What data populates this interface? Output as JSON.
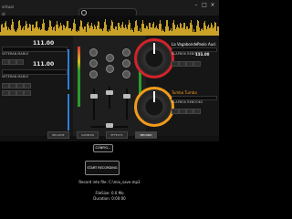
{
  "app": {
    "logo_text": "virtual dj"
  },
  "search": {
    "placeholder": ""
  },
  "window_controls": [
    "–",
    "□",
    "×"
  ],
  "deck_left": {
    "bpm": "111.00",
    "track_top": "VETERAN MARLE",
    "track_bottom": "VETERAN MARLE"
  },
  "deck_right": {
    "title": "La Vagabonde",
    "artist": "Paolo Auci",
    "track_top": "SLAPBOX REBOOKS",
    "bpm_top": "111.00",
    "title_bottom": "Tumba Tumba",
    "track_bottom": "SLAPBOX REBOOKS"
  },
  "tabs": [
    "BROWSE",
    "SAMPLER",
    "EFFECTS",
    "RECORD"
  ],
  "active_tab": "RECORD",
  "record": {
    "config_label": "CONFIG...",
    "start_label": "START RECORDING",
    "record_into": "Record into file: C:\\mix_save.mp3",
    "file_size": "FileSize: 0.0 Mo",
    "duration": "Duration: 0:00:00"
  },
  "colors": {
    "accent_red": "#d2232a",
    "accent_orange": "#f29a1a",
    "wave_gold": "#c9a227",
    "vu_blue": "#2f7fd6"
  }
}
